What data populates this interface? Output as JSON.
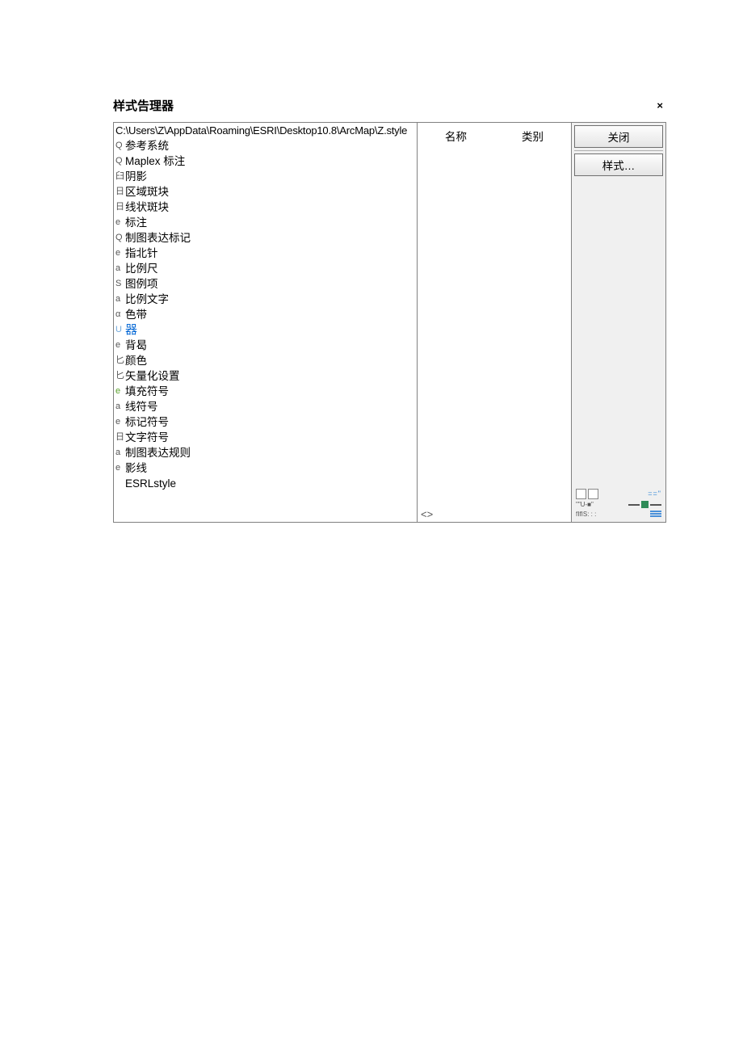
{
  "title": "样式告理器",
  "close_x": "×",
  "tree": {
    "path": "C:\\Users\\Z\\AppData\\Roaming\\ESRI\\Desktop10.8\\ArcMap\\Z.style",
    "items": [
      {
        "prefix": "Q",
        "label": "参考系统"
      },
      {
        "prefix": "Q",
        "label": "Maplex 标注"
      },
      {
        "prefix": "臼",
        "label": "阴影"
      },
      {
        "prefix": "日",
        "label": "区域斑块"
      },
      {
        "prefix": "日",
        "label": "线状斑块"
      },
      {
        "prefix": "e",
        "label": "标注"
      },
      {
        "prefix": "Q",
        "label": "制图表达标记"
      },
      {
        "prefix": "e",
        "label": "指北针"
      },
      {
        "prefix": "a",
        "label": "比例尺"
      },
      {
        "prefix": "S",
        "label": "图例项"
      },
      {
        "prefix": "a",
        "label": "比例文字"
      },
      {
        "prefix": "α",
        "label": "色带"
      },
      {
        "prefix": "U",
        "label": "器",
        "selected": true
      },
      {
        "prefix": "e",
        "label": "背曷"
      },
      {
        "prefix": "匕",
        "label": "颜色"
      },
      {
        "prefix": "匕",
        "label": "矢量化设置"
      },
      {
        "prefix": "e",
        "label": "填充符号"
      },
      {
        "prefix": "a",
        "label": "线符号"
      },
      {
        "prefix": "e",
        "label": "标记符号"
      },
      {
        "prefix": "日",
        "label": "文字符号"
      },
      {
        "prefix": "a",
        "label": "制图表达规则"
      },
      {
        "prefix": "e",
        "label": "影线"
      },
      {
        "prefix": "",
        "label": "ESRLstyle"
      }
    ]
  },
  "list": {
    "headers": {
      "name": "名称",
      "category": "类别"
    },
    "footer": "<>"
  },
  "right": {
    "close": "关闭",
    "styles": "样式…"
  },
  "preview": {
    "row2_left": "\"\"U-■\"",
    "row3_left": "fIfIS:  :  :"
  }
}
